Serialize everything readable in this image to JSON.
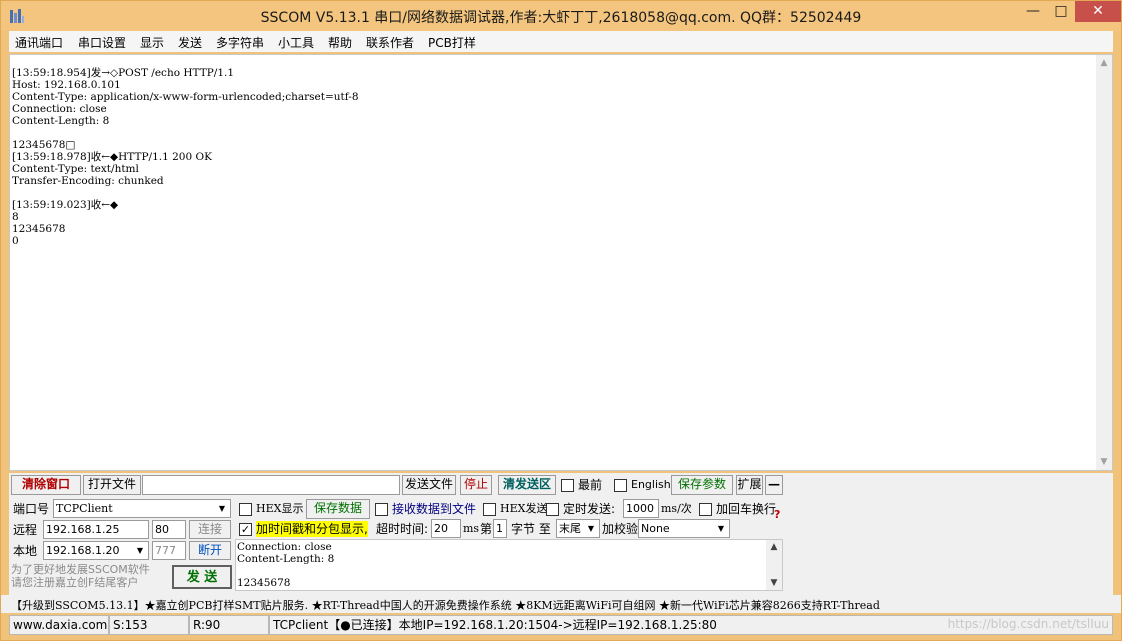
{
  "window": {
    "title": "SSCOM V5.13.1 串口/网络数据调试器,作者:大虾丁丁,2618058@qq.com. QQ群：52502449",
    "minimize": "—",
    "maximize": "□",
    "close": "✕"
  },
  "menu": [
    "通讯端口",
    "串口设置",
    "显示",
    "发送",
    "多字符串",
    "小工具",
    "帮助",
    "联系作者",
    "PCB打样"
  ],
  "receive": {
    "lines": [
      "[13:59:18.954]发→◇POST /echo HTTP/1.1",
      "Host: 192.168.0.101",
      "Content-Type: application/x-www-form-urlencoded;charset=utf-8",
      "Connection: close",
      "Content-Length: 8",
      "",
      "12345678□",
      "[13:59:18.978]收←◆HTTP/1.1 200 OK",
      "Content-Type: text/html",
      "Transfer-Encoding: chunked",
      "",
      "[13:59:19.023]收←◆",
      "8",
      "12345678",
      "0"
    ]
  },
  "toolbar": {
    "clear": "清除窗口",
    "open_file": "打开文件",
    "file_path": "",
    "send_file": "发送文件",
    "stop": "停止",
    "clear_send": "清发送区",
    "topmost": "最前",
    "english": "English",
    "save_params": "保存参数",
    "expand": "扩展",
    "collapse": "—"
  },
  "port": {
    "port_label": "端口号",
    "port_value": "TCPClient",
    "remote_label": "远程",
    "remote_ip": "192.168.1.25",
    "remote_port": "80",
    "connect": "连接",
    "local_label": "本地",
    "local_ip": "192.168.1.20",
    "local_port": "777",
    "disconnect": "断开",
    "promo_line1": "为了更好地发展SSCOM软件",
    "promo_line2": "请您注册嘉立创F结尾客户",
    "send": "发  送"
  },
  "options": {
    "hex_display": "HEX显示",
    "save_data": "保存数据",
    "recv_to_file": "接收数据到文件",
    "hex_send": "HEX发送",
    "timed_send": "定时发送:",
    "interval": "1000",
    "interval_unit": "ms/次",
    "add_crlf": "加回车换行",
    "timestamp": "加时间戳和分包显示,",
    "timeout_label": "超时时间:",
    "timeout_value": "20",
    "timeout_unit": "ms",
    "nth_label": "第",
    "nth_value": "1",
    "byte_label": "字节 至",
    "end_value": "末尾",
    "checksum_label": "加校验",
    "checksum_value": "None"
  },
  "send_area": {
    "lines": [
      "Connection: close",
      "Content-Length: 8",
      "",
      "12345678"
    ]
  },
  "promo_bar": "【升级到SSCOM5.13.1】★嘉立创PCB打样SMT贴片服务. ★RT-Thread中国人的开源免费操作系统 ★8KM远距离WiFi可自组网 ★新一代WiFi芯片兼容8266支持RT-Thread",
  "status": {
    "site": "www.daxia.com",
    "sent": "S:153",
    "received": "R:90",
    "connection": "TCPclient【●已连接】本地IP=192.168.1.20:1504->远程IP=192.168.1.25:80",
    "watermark": "https://blog.csdn.net/tslIuu"
  },
  "colors": {
    "titlebar": "#f3c57e",
    "close_button": "#c7504a",
    "highlight": "#ffff00"
  }
}
